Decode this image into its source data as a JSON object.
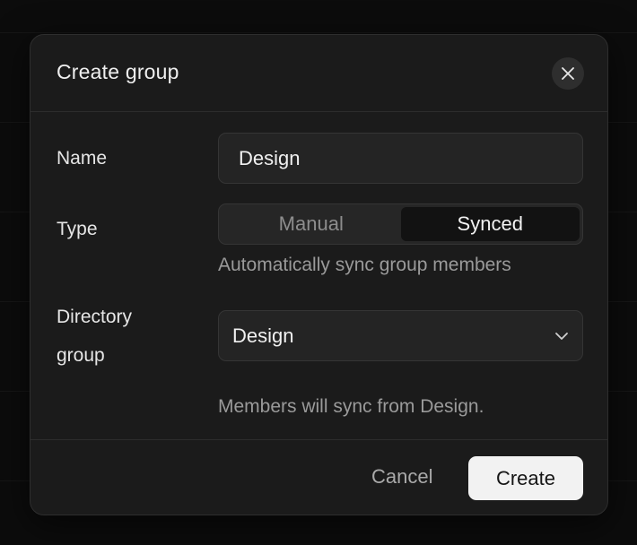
{
  "dialog": {
    "title": "Create group",
    "close_icon": "close-icon"
  },
  "form": {
    "name": {
      "label": "Name",
      "value": "Design"
    },
    "type": {
      "label": "Type",
      "options": [
        "Manual",
        "Synced"
      ],
      "selected": "Synced",
      "help": "Automatically sync group members"
    },
    "directory_group": {
      "label_line1": "Directory",
      "label_line2": "group",
      "value": "Design",
      "dropdown_icon": "chevron-down-icon",
      "help": "Members will sync from Design."
    }
  },
  "footer": {
    "cancel_label": "Cancel",
    "create_label": "Create"
  }
}
